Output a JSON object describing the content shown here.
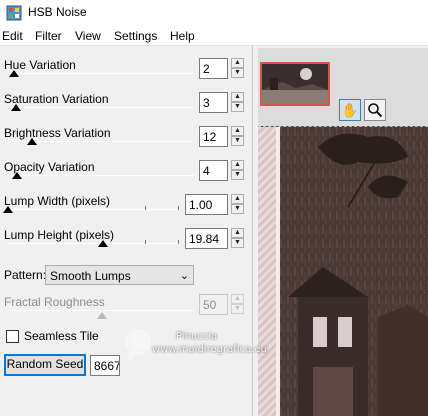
{
  "window": {
    "title": "HSB Noise"
  },
  "menu": [
    "Edit",
    "Filter",
    "View",
    "Settings",
    "Help"
  ],
  "sliders": [
    {
      "label": "Hue Variation",
      "value": "2",
      "level": 0.02,
      "enabled": true
    },
    {
      "label": "Saturation Variation",
      "value": "3",
      "level": 0.03,
      "enabled": true
    },
    {
      "label": "Brightness Variation",
      "value": "12",
      "level": 0.12,
      "enabled": true
    },
    {
      "label": "Opacity Variation",
      "value": "4",
      "level": 0.04,
      "enabled": true
    },
    {
      "label": "Lump Width (pixels)",
      "value": "1.00",
      "level": 0.0,
      "enabled": true
    },
    {
      "label": "Lump Height (pixels)",
      "value": "19.84",
      "level": 0.55,
      "enabled": true
    },
    {
      "label": "Fractal Roughness",
      "value": "50",
      "level": 0.5,
      "enabled": false
    }
  ],
  "pattern": {
    "label": "Pattern:",
    "selected": "Smooth Lumps"
  },
  "seamless": {
    "label": "Seamless Tile",
    "checked": false
  },
  "seed": {
    "button_label": "Random Seed",
    "value": "8667"
  },
  "tools": {
    "pan_icon": "hand-icon",
    "zoom_icon": "magnifier-icon"
  },
  "watermark": {
    "line1": "Pinuccia",
    "line2": "www.maidiregrafica.eu"
  },
  "colors": {
    "accent": "#0078d7",
    "thumb_border": "#e05050",
    "preview_bg": "#4a3934"
  }
}
